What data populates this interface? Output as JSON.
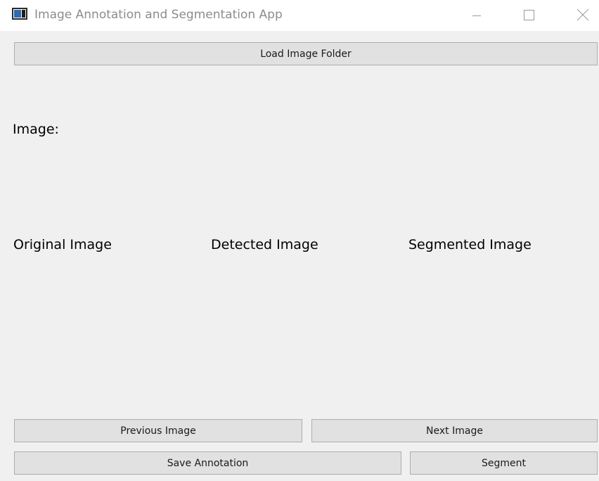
{
  "window": {
    "title": "Image Annotation and Segmentation App",
    "icon": "app-window-icon",
    "controls": {
      "minimize_icon": "minimize-icon",
      "maximize_icon": "maximize-icon",
      "close_icon": "close-icon"
    }
  },
  "toolbar": {
    "load_folder_label": "Load Image Folder"
  },
  "main": {
    "image_label": "Image:",
    "panels": {
      "original": "Original Image",
      "detected": "Detected Image",
      "segmented": "Segmented Image"
    }
  },
  "footer": {
    "previous_label": "Previous Image",
    "next_label": "Next Image",
    "save_label": "Save Annotation",
    "segment_label": "Segment"
  },
  "colors": {
    "window_bg": "#f0f0f0",
    "button_bg": "#e1e1e1",
    "button_border": "#adadad",
    "title_text": "#8c8c8c"
  }
}
